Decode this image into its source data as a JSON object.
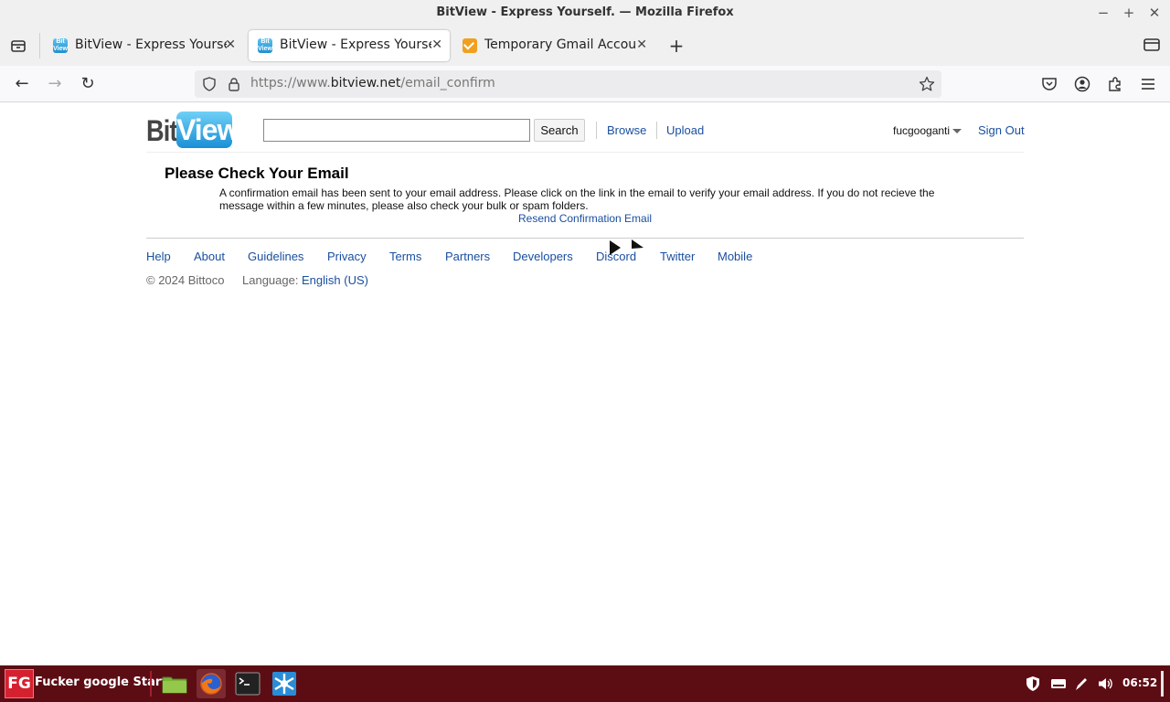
{
  "window": {
    "title": "BitView - Express Yourself. — Mozilla Firefox",
    "minimize": "−",
    "maximize": "+",
    "close": "✕"
  },
  "tabs": [
    {
      "label": "BitView - Express Yourself.",
      "favicon": "bitview-favicon",
      "selected": false
    },
    {
      "label": "BitView - Express Yourself.",
      "favicon": "bitview-favicon",
      "selected": true
    },
    {
      "label": "Temporary Gmail Account",
      "favicon": "mail-favicon",
      "selected": false
    }
  ],
  "tab_close": "✕",
  "newtab": "+",
  "favicon_text": "Bit View",
  "nav": {
    "back": "←",
    "forward": "→",
    "reload": "↻",
    "url_scheme": "https://www.",
    "url_host": "bitview.net",
    "url_path": "/email_confirm"
  },
  "site": {
    "logo_bit": "Bit",
    "logo_view": "View",
    "search_value": "",
    "search_button": "Search",
    "browse": "Browse",
    "upload": "Upload",
    "username": "fucgooganti",
    "signout": "Sign Out"
  },
  "main": {
    "heading": "Please Check Your Email",
    "message": "A confirmation email has been sent to your email address. Please click on the link in the email to verify your email address. If you do not recieve the message within a few minutes, please also check your bulk or spam folders.",
    "resend": "Resend Confirmation Email"
  },
  "footer": {
    "links": [
      "Help",
      "About",
      "Guidelines",
      "Privacy",
      "Terms",
      "Partners",
      "Developers",
      "Discord",
      "Twitter",
      "Mobile"
    ],
    "copyright": "© 2024 Bittoco",
    "language_label": "Language:",
    "language_value": "English (US)"
  },
  "taskbar": {
    "start_logo": "FG",
    "start_label": "Fucker google Start",
    "apps": [
      "file-manager-icon",
      "firefox-icon",
      "terminal-icon",
      "network-manager-icon"
    ],
    "clock": "06:52"
  },
  "colors": {
    "link": "#1a4fa0",
    "taskbar": "#5c0d14",
    "logo_blue": "#1a8fd6"
  }
}
